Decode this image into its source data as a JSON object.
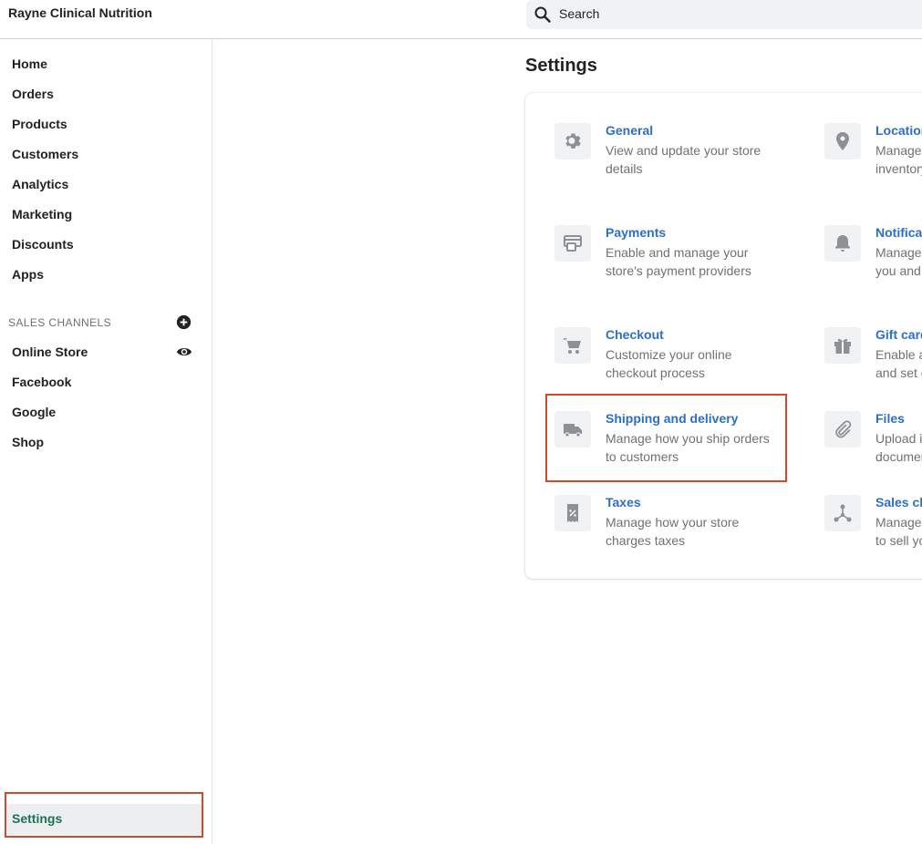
{
  "header": {
    "store_name": "Rayne Clinical Nutrition",
    "search_placeholder": "Search"
  },
  "sidebar": {
    "items": [
      {
        "label": "Home"
      },
      {
        "label": "Orders"
      },
      {
        "label": "Products"
      },
      {
        "label": "Customers"
      },
      {
        "label": "Analytics"
      },
      {
        "label": "Marketing"
      },
      {
        "label": "Discounts"
      },
      {
        "label": "Apps"
      }
    ],
    "sales_channels_title": "SALES CHANNELS",
    "channels": [
      {
        "label": "Online Store"
      },
      {
        "label": "Facebook"
      },
      {
        "label": "Google"
      },
      {
        "label": "Shop"
      }
    ],
    "settings_label": "Settings"
  },
  "main": {
    "title": "Settings",
    "tiles": [
      {
        "title": "General",
        "desc": "View and update your store details",
        "icon": "gear-icon"
      },
      {
        "title": "Locations",
        "desc": "Manage the places you stock inventory and fulfill products",
        "icon": "location-pin-icon"
      },
      {
        "title": "Payments",
        "desc": "Enable and manage your store's payment providers",
        "icon": "payment-icon"
      },
      {
        "title": "Notifications",
        "desc": "Manage notifications sent to you and your customers",
        "icon": "bell-icon"
      },
      {
        "title": "Checkout",
        "desc": "Customize your online checkout process",
        "icon": "cart-icon"
      },
      {
        "title": "Gift cards",
        "desc": "Enable automatic expiration and set gift card rules",
        "icon": "gift-icon"
      },
      {
        "title": "Shipping and delivery",
        "desc": "Manage how you ship orders to customers",
        "icon": "truck-icon"
      },
      {
        "title": "Files",
        "desc": "Upload images, videos, and documents",
        "icon": "paperclip-icon"
      },
      {
        "title": "Taxes",
        "desc": "Manage how your store charges taxes",
        "icon": "tax-receipt-icon"
      },
      {
        "title": "Sales channels",
        "desc": "Manage the channels you use to sell your products",
        "icon": "channels-icon"
      }
    ]
  },
  "colors": {
    "link": "#2c6ecb",
    "highlight": "#d9472b",
    "active_nav": "#1a7254"
  }
}
